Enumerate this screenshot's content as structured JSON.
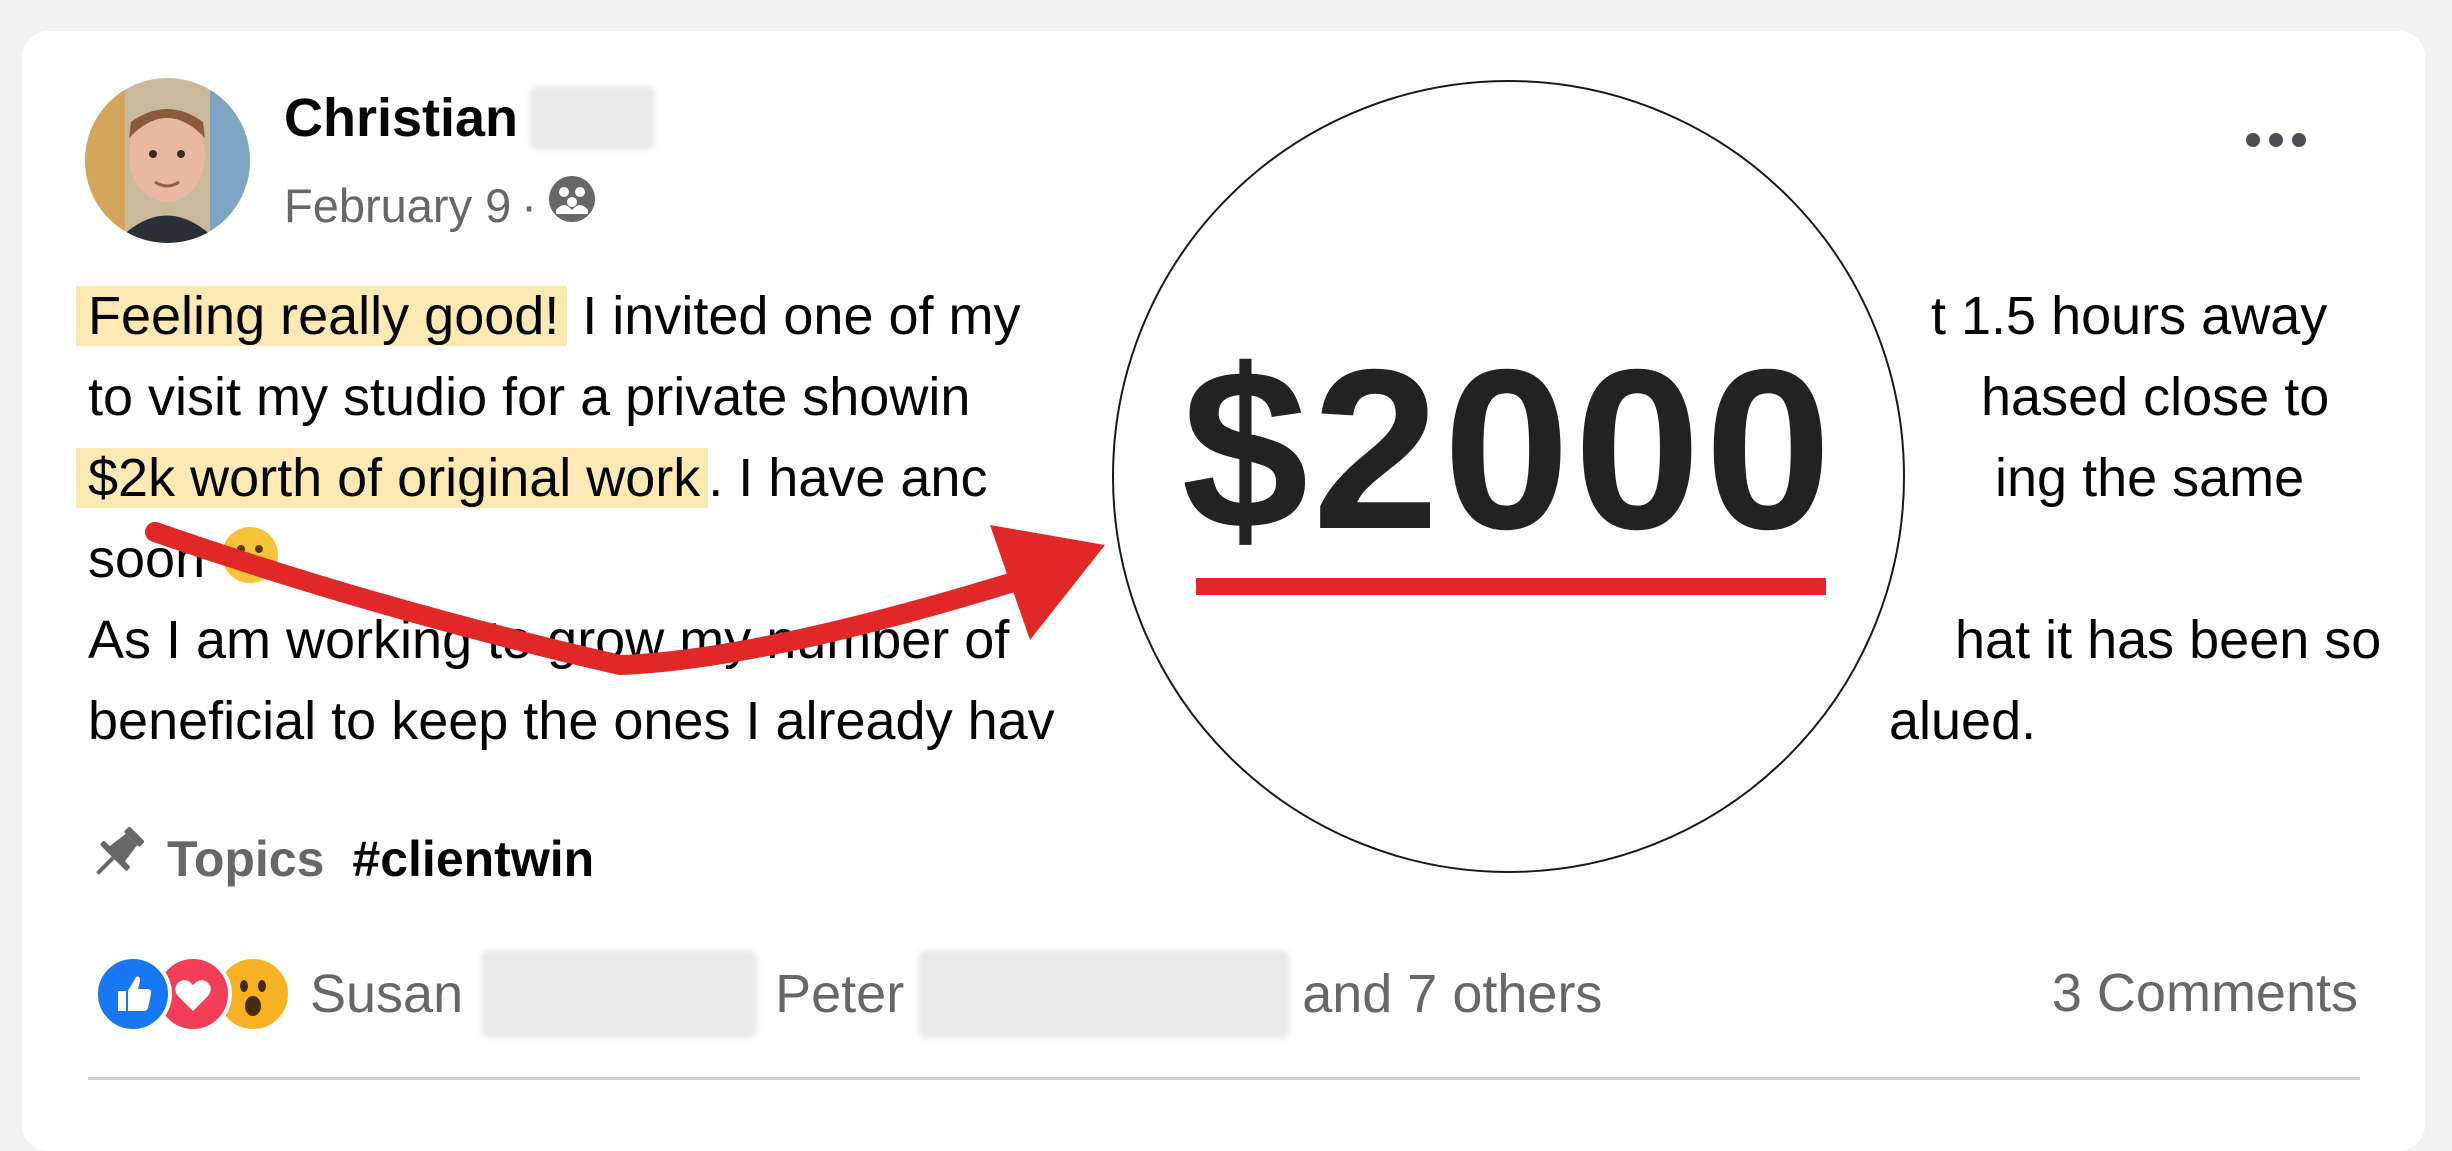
{
  "post": {
    "author_name": "Christian",
    "date": "February 9",
    "separator": "·",
    "lines": [
      {
        "highlight": "Feeling really good!",
        "text": " I invited one of my",
        "tail": "t 1.5 hours away"
      },
      {
        "text": "to visit my studio for a private showin",
        "tail": "hased close to"
      },
      {
        "highlight": "$2k worth of original work",
        "text": ". I have anc",
        "tail": "ing the same"
      },
      {
        "text": "soon "
      },
      {
        "text": "As I am working to grow my number of",
        "tail": "hat it has been so"
      },
      {
        "text": "beneficial to keep the ones I already hav",
        "tail": "alued."
      }
    ]
  },
  "topics": {
    "label": "Topics",
    "tag": "#clientwin"
  },
  "reactions": {
    "name_1": "Susan",
    "name_2": "Peter",
    "others": "and 7 others",
    "comments": "3 Comments"
  },
  "callout": {
    "amount": "$2000"
  },
  "colors": {
    "highlight": "#fce9b4",
    "accent_red": "#e02828",
    "like_blue": "#1877f2",
    "love_red": "#f33e58",
    "wow_yellow": "#f7b125"
  },
  "icons": {
    "more": "ellipsis-icon",
    "audience": "group-icon",
    "topics": "pin-icon",
    "emoji": "slightly-smiling-face-icon"
  }
}
